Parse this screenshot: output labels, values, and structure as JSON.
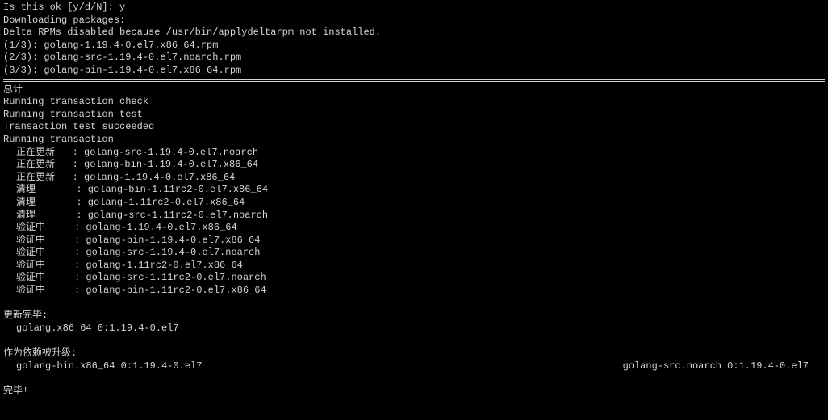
{
  "top": {
    "prompt": "Is this ok [y/d/N]: y",
    "blank": "",
    "downloading": "Downloading packages:",
    "delta": "Delta RPMs disabled because /usr/bin/applydeltarpm not installed.",
    "pkg1": "(1/3): golang-1.19.4-0.el7.x86_64.rpm",
    "pkg2": "(2/3): golang-src-1.19.4-0.el7.noarch.rpm",
    "pkg3": "(3/3): golang-bin-1.19.4-0.el7.x86_64.rpm"
  },
  "summary_header": "总计",
  "tx": {
    "check": "Running transaction check",
    "test": "Running transaction test",
    "succeeded": "Transaction test succeeded",
    "running": "Running transaction",
    "rows": [
      {
        "label": "正在更新   ",
        "pkg": ": golang-src-1.19.4-0.el7.noarch"
      },
      {
        "label": "正在更新   ",
        "pkg": ": golang-bin-1.19.4-0.el7.x86_64"
      },
      {
        "label": "正在更新   ",
        "pkg": ": golang-1.19.4-0.el7.x86_64"
      },
      {
        "label": "清理       ",
        "pkg": ": golang-bin-1.11rc2-0.el7.x86_64"
      },
      {
        "label": "清理       ",
        "pkg": ": golang-1.11rc2-0.el7.x86_64"
      },
      {
        "label": "清理       ",
        "pkg": ": golang-src-1.11rc2-0.el7.noarch"
      },
      {
        "label": "验证中     ",
        "pkg": ": golang-1.19.4-0.el7.x86_64"
      },
      {
        "label": "验证中     ",
        "pkg": ": golang-bin-1.19.4-0.el7.x86_64"
      },
      {
        "label": "验证中     ",
        "pkg": ": golang-src-1.19.4-0.el7.noarch"
      },
      {
        "label": "验证中     ",
        "pkg": ": golang-1.11rc2-0.el7.x86_64"
      },
      {
        "label": "验证中     ",
        "pkg": ": golang-src-1.11rc2-0.el7.noarch"
      },
      {
        "label": "验证中     ",
        "pkg": ": golang-bin-1.11rc2-0.el7.x86_64"
      }
    ]
  },
  "updated": {
    "header": "更新完毕:",
    "item": "golang.x86_64 0:1.19.4-0.el7"
  },
  "deps": {
    "header": "作为依赖被升级:",
    "item1": "golang-bin.x86_64 0:1.19.4-0.el7",
    "item2": "golang-src.noarch 0:1.19.4-0.el7"
  },
  "complete": "完毕!"
}
